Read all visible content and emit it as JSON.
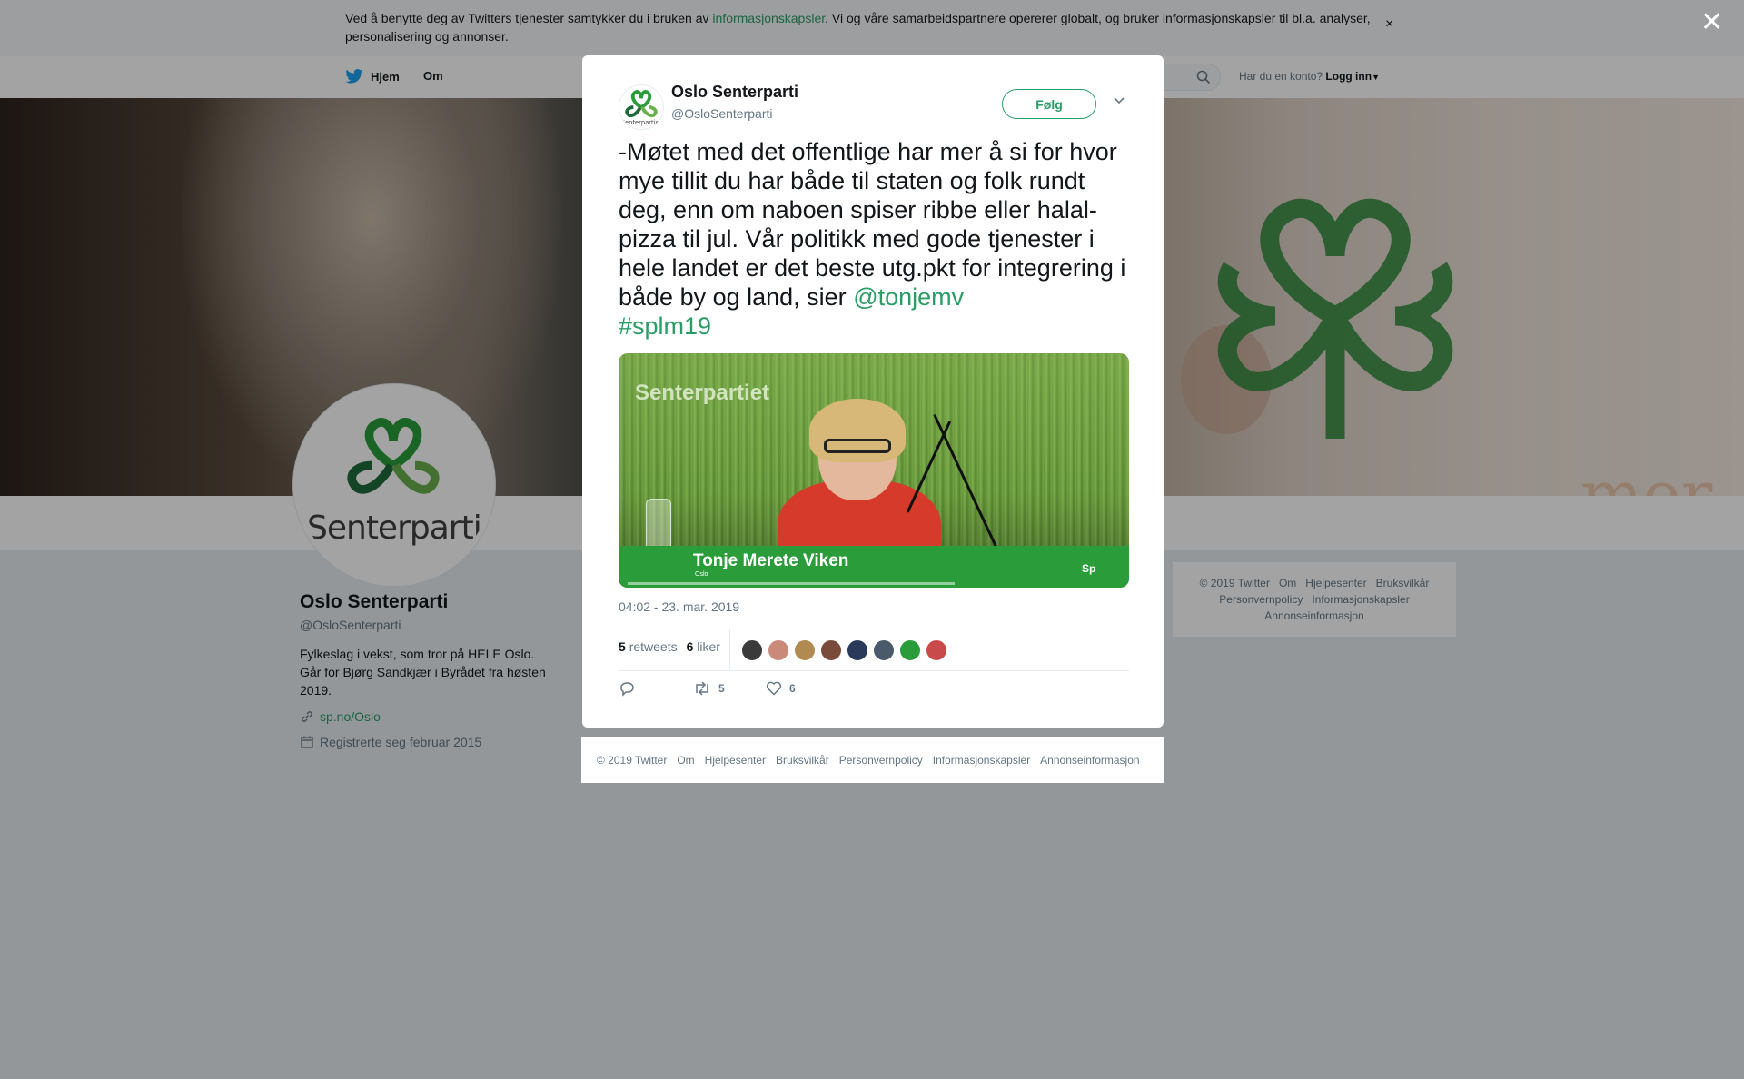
{
  "cookie": {
    "text_before": "Ved å benytte deg av Twitters tjenester samtykker du i bruken av ",
    "link": "informasjonskapsler",
    "text_after": ". Vi og våre samarbeidspartnere opererer globalt, og bruker informasjonskapsler til bl.a. analyser, personalisering og annonser.",
    "close": "×"
  },
  "nav": {
    "home": "Hjem",
    "about": "Om",
    "login_prompt": "Har du en konto?",
    "login": "Logg inn"
  },
  "banner": {
    "text": "mer folk"
  },
  "profile": {
    "avatar_text": "Senterpartiet",
    "name": "Oslo Senterparti",
    "handle": "@OsloSenterparti",
    "bio": "Fylkeslag i vekst, som tror på HELE Oslo. Går for Bjørg Sandkjær i Byrådet fra høsten 2019.",
    "url": "sp.no/Oslo",
    "joined": "Registrerte seg februar 2015"
  },
  "side_footer": [
    "© 2019 Twitter",
    "Om",
    "Hjelpesenter",
    "Bruksvilkår",
    "Personvernpolicy",
    "Informasjonskapsler",
    "Annonseinformasjon"
  ],
  "overlay": {
    "close": "✕"
  },
  "tweet": {
    "author_name": "Oslo Senterparti",
    "author_handle": "@OsloSenterparti",
    "follow_label": "Følg",
    "text": "-Møtet med det offentlige har mer å si for hvor mye tillit du har både til staten og folk rundt deg, enn om naboen spiser ribbe eller halal-pizza til jul. Vår politikk med gode tjenester i hele landet er det beste utg.pkt for integrering i både by og land, sier ",
    "mention": "@tonjemv",
    "hashtag": "#splm19",
    "media": {
      "logo": "Senterpartiet",
      "lower_third_name": "Tonje Merete Viken",
      "lower_third_sub": "Oslo",
      "corner_mark": "Sp"
    },
    "timestamp": "04:02 - 23. mar. 2019",
    "retweets_count": "5",
    "retweets_label": "retweets",
    "likes_count": "6",
    "likes_label": "liker",
    "likers_colors": [
      "#3a3a3a",
      "#c98a7a",
      "#b08a50",
      "#7a4a3a",
      "#2a3a5a",
      "#4a5a6a",
      "#2a9d3a",
      "#c94a4a"
    ],
    "reply_count": "",
    "retweet_action_count": "5",
    "like_action_count": "6"
  },
  "modal_footer": [
    "© 2019 Twitter",
    "Om",
    "Hjelpesenter",
    "Bruksvilkår",
    "Personvernpolicy",
    "Informasjonskapsler",
    "Annonseinformasjon"
  ],
  "colors": {
    "accent": "#2a9d67",
    "text": "#14171a",
    "muted": "#657786"
  }
}
